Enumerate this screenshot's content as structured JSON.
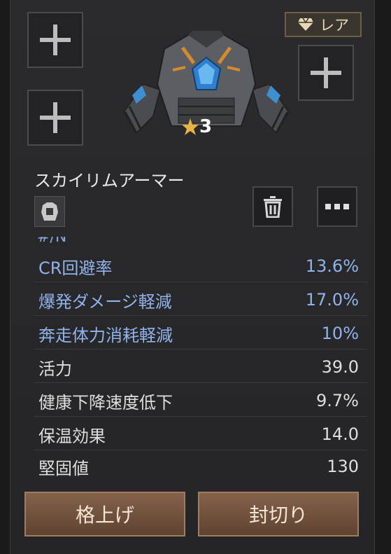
{
  "rarity": {
    "label": "レア",
    "icon": "diamond-icon",
    "color": "#e8d9b6"
  },
  "item": {
    "name": "スカイリムアーマー",
    "level": "3"
  },
  "stats_partial_label": "#/N",
  "stats": [
    {
      "label": "CR回避率",
      "value": "13.6%",
      "highlight": true
    },
    {
      "label": "爆発ダメージ軽減",
      "value": "17.0%",
      "highlight": true
    },
    {
      "label": "奔走体力消耗軽減",
      "value": "10%",
      "highlight": true
    },
    {
      "label": "活力",
      "value": "39.0",
      "highlight": false
    },
    {
      "label": "健康下降速度低下",
      "value": "9.7%",
      "highlight": false
    },
    {
      "label": "保温効果",
      "value": "14.0",
      "highlight": false
    },
    {
      "label": "堅固値",
      "value": "130",
      "highlight": false
    }
  ],
  "buttons": {
    "upgrade": "格上げ",
    "unseal": "封切り"
  },
  "colors": {
    "highlight_stat": "#8fb3ea",
    "button": "#74553f",
    "rarity_border": "#6d5f44"
  }
}
